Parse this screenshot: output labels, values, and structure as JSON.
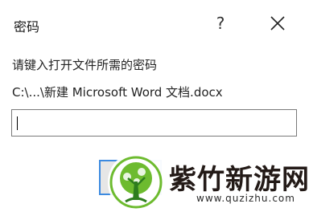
{
  "window": {
    "title": "密码",
    "help_label": "?"
  },
  "dialog": {
    "prompt": "请键入打开文件所需的密码",
    "file_path": "C:\\...\\新建 Microsoft Word 文档.docx",
    "password_value": ""
  },
  "watermark": {
    "name": "紫竹新游网",
    "url": "www.quzizhu.com"
  },
  "colors": {
    "accent": "#3c8ae0",
    "logo_green": "#6dbb2f",
    "logo_dark": "#2e7d1e"
  }
}
